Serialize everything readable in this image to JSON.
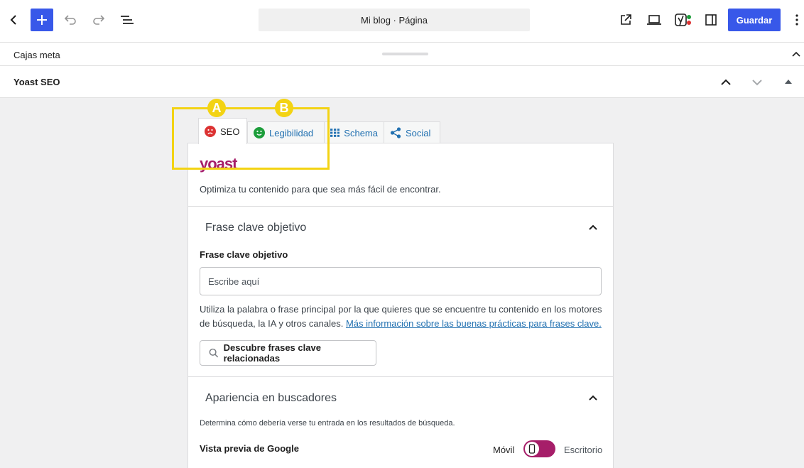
{
  "toolbar": {
    "document_title": "Mi blog · Página",
    "save_label": "Guardar"
  },
  "metabox": {
    "label": "Cajas meta"
  },
  "panel": {
    "title": "Yoast SEO"
  },
  "annotations": {
    "a": "A",
    "b": "B"
  },
  "tabs": [
    {
      "label": "SEO",
      "icon": "sad-face-icon"
    },
    {
      "label": "Legibilidad",
      "icon": "smile-face-icon"
    },
    {
      "label": "Schema",
      "icon": "grid-icon"
    },
    {
      "label": "Social",
      "icon": "share-icon"
    }
  ],
  "brand": {
    "logo": "yoast",
    "tagline": "Optimiza tu contenido para que sea más fácil de encontrar."
  },
  "keyphrase": {
    "section_title": "Frase clave objetivo",
    "field_label": "Frase clave objetivo",
    "placeholder": "Escribe aquí",
    "help_text": "Utiliza la palabra o frase principal por la que quieres que se encuentre tu contenido en los motores de búsqueda, la IA y otros canales. ",
    "help_link": "Más información sobre las buenas prácticas para frases clave.",
    "related_button": "Descubre frases clave relacionadas"
  },
  "search_appearance": {
    "section_title": "Apariencia en buscadores",
    "description": "Determina cómo debería verse tu entrada en los resultados de búsqueda.",
    "preview_label": "Vista previa de Google",
    "mobile_label": "Móvil",
    "desktop_label": "Escritorio"
  },
  "colors": {
    "accent": "#3858e9",
    "brand": "#a61e69",
    "highlight": "#f3d313",
    "link": "#2271b1",
    "bad": "#dc3232",
    "good": "#1c9d3a"
  }
}
